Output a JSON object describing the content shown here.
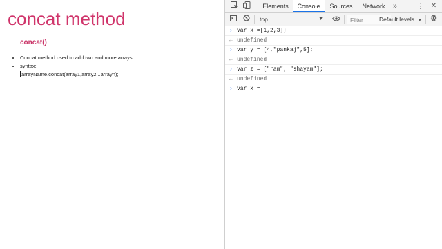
{
  "page": {
    "title": "concat method",
    "subtitle": "concat()",
    "bullets": [
      "Concat method used to add two and more arrays.",
      "syntax:"
    ],
    "syntax_code": "arrayName.concat(array1,array2...arrayn);"
  },
  "devtools": {
    "tabs": [
      "Elements",
      "Console",
      "Sources",
      "Network"
    ],
    "active_tab": "Console",
    "more_tabs_glyph": "»",
    "kebab_glyph": "⋮",
    "close_glyph": "✕",
    "context": "top",
    "filter_placeholder": "Filter",
    "levels_label": "Default levels",
    "accent_color": "#1a73e8"
  },
  "console": {
    "input_glyph": "›",
    "output_glyph": "←",
    "entries": [
      {
        "kind": "input",
        "text": "var x =[1,2,3];"
      },
      {
        "kind": "output",
        "text": "undefined"
      },
      {
        "kind": "input",
        "text": "var y = [4,\"pankaj\",5];"
      },
      {
        "kind": "output",
        "text": "undefined"
      },
      {
        "kind": "input",
        "text": "var z = [\"ram\", \"shayam\"];"
      },
      {
        "kind": "output",
        "text": "undefined"
      }
    ],
    "prompt_text": "var x = "
  }
}
